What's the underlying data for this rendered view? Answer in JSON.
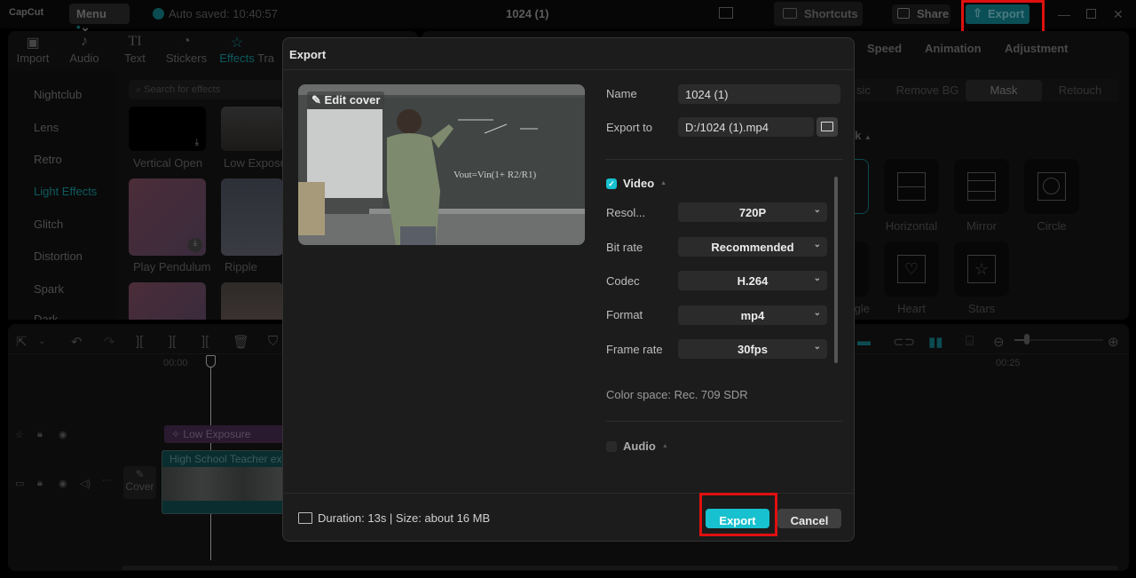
{
  "app": {
    "logo": "CapCut",
    "menu_label": "Menu",
    "autosave": "Auto saved: 10:40:57",
    "project_title": "1024 (1)",
    "shortcuts_label": "Shortcuts",
    "share_label": "Share",
    "export_label": "Export"
  },
  "toolbar": [
    {
      "label": "Import",
      "icon": "import-icon"
    },
    {
      "label": "Audio",
      "icon": "audio-icon"
    },
    {
      "label": "Text",
      "icon": "text-icon"
    },
    {
      "label": "Stickers",
      "icon": "stickers-icon"
    },
    {
      "label": "Effects",
      "icon": "effects-icon",
      "active": true
    },
    {
      "label": "Tra",
      "icon": "transitions-icon"
    }
  ],
  "sidebar": {
    "items": [
      "Nightclub",
      "Lens",
      "Retro",
      "Light Effects",
      "Glitch",
      "Distortion",
      "Spark",
      "Dark"
    ],
    "active": "Light Effects"
  },
  "effects": {
    "search_placeholder": "Search for effects",
    "items": [
      "Vertical Open",
      "Low Exposu",
      "Play Pendulum",
      "Ripple"
    ]
  },
  "right_panel": {
    "tabs": [
      "Speed",
      "Animation",
      "Adjustment"
    ],
    "segments": [
      "sic",
      "Remove BG",
      "Mask",
      "Retouch"
    ],
    "active_segment": "Mask",
    "section_label": "k",
    "masks": [
      "Horizontal",
      "Mirror",
      "Circle",
      "gle",
      "Heart",
      "Stars"
    ]
  },
  "timeline": {
    "ruler": [
      "00:00",
      "00:25"
    ],
    "effect_clip": "Low Exposure",
    "video_clip": "High School Teacher exp",
    "cover_label": "Cover",
    "zoom_level": 0.15
  },
  "dialog": {
    "title": "Export",
    "edit_cover": "Edit cover",
    "name_label": "Name",
    "name_value": "1024 (1)",
    "export_to_label": "Export to",
    "export_to_value": "D:/1024 (1).mp4",
    "video": {
      "label": "Video",
      "checked": true,
      "resolution_label": "Resol...",
      "resolution": "720P",
      "bitrate_label": "Bit rate",
      "bitrate": "Recommended",
      "codec_label": "Codec",
      "codec": "H.264",
      "format_label": "Format",
      "format": "mp4",
      "framerate_label": "Frame rate",
      "framerate": "30fps",
      "color_space": "Color space: Rec. 709 SDR"
    },
    "audio": {
      "label": "Audio",
      "checked": false
    },
    "footer_info": "Duration: 13s | Size: about 16 MB",
    "export_button": "Export",
    "cancel_button": "Cancel"
  },
  "colors": {
    "accent": "#17c1cf",
    "highlight": "#e01010"
  }
}
